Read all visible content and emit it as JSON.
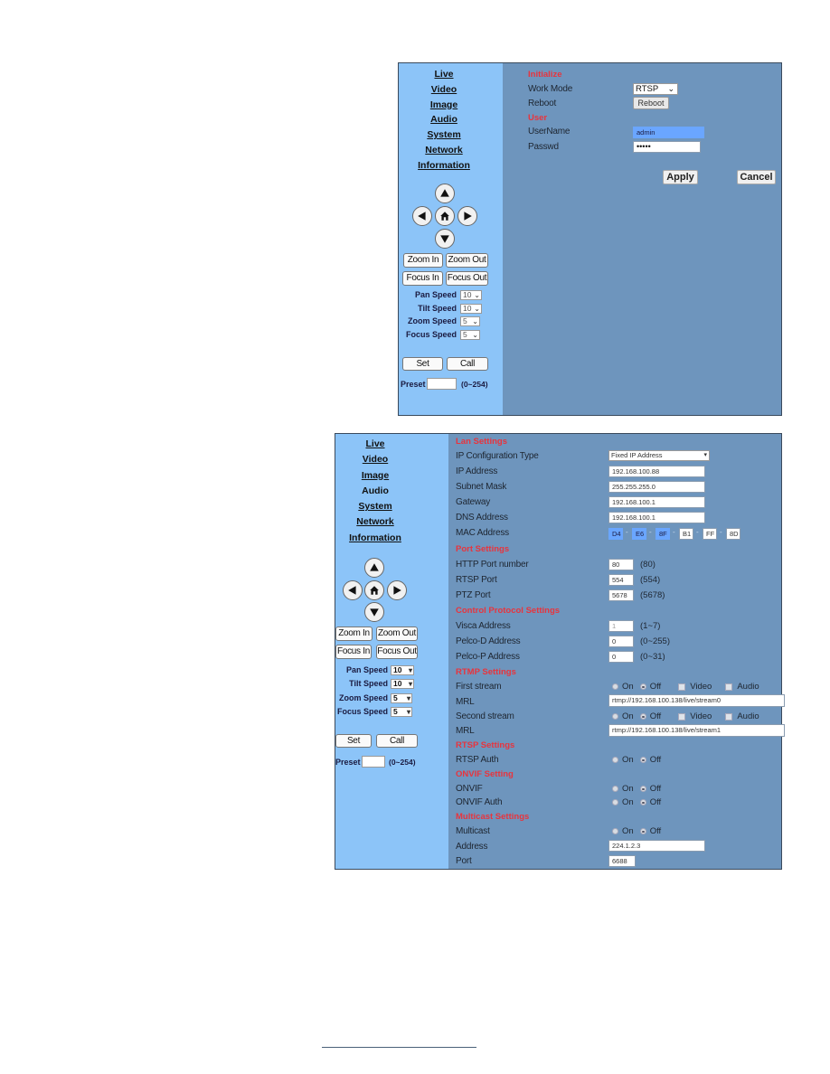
{
  "nav": {
    "items": [
      "Live",
      "Video",
      "Image",
      "Audio",
      "System",
      "Network",
      "Information"
    ]
  },
  "ptz": {
    "icons": [
      "up-arrow-icon",
      "left-arrow-icon",
      "home-icon",
      "right-arrow-icon",
      "down-arrow-icon"
    ],
    "zoom_in": "Zoom In",
    "zoom_out": "Zoom Out",
    "focus_in": "Focus In",
    "focus_out": "Focus Out",
    "speeds": [
      {
        "label": "Pan Speed",
        "value": "10"
      },
      {
        "label": "Tilt Speed",
        "value": "10"
      },
      {
        "label": "Zoom Speed",
        "value": "5"
      },
      {
        "label": "Focus Speed",
        "value": "5"
      }
    ],
    "set": "Set",
    "call": "Call",
    "preset_label": "Preset",
    "preset_value": "",
    "preset_range": "(0~254)"
  },
  "system_panel": {
    "initialize_title": "Initialize",
    "work_mode_label": "Work Mode",
    "work_mode_value": "RTSP",
    "reboot_label": "Reboot",
    "reboot_button": "Reboot",
    "user_title": "User",
    "username_label": "UserName",
    "username_value": "admin",
    "password_label": "Passwd",
    "password_value": "•••••",
    "apply": "Apply",
    "cancel": "Cancel"
  },
  "network_panel": {
    "lan_title": "Lan Settings",
    "ip_config_label": "IP Configuration Type",
    "ip_config_value": "Fixed IP Address",
    "ip_label": "IP Address",
    "ip_value": "192.168.100.88",
    "subnet_label": "Subnet Mask",
    "subnet_value": "255.255.255.0",
    "gateway_label": "Gateway",
    "gateway_value": "192.168.100.1",
    "dns_label": "DNS Address",
    "dns_value": "192.168.100.1",
    "mac_label": "MAC Address",
    "mac_values": [
      "D4",
      "E6",
      "8F",
      "B1",
      "FF",
      "8D"
    ],
    "port_title": "Port Settings",
    "http_label": "HTTP Port number",
    "http_value": "80",
    "http_default": "(80)",
    "rtsp_label": "RTSP Port",
    "rtsp_value": "554",
    "rtsp_default": "(554)",
    "ptz_label": "PTZ Port",
    "ptz_value": "5678",
    "ptz_default": "(5678)",
    "control_title": "Control Protocol Settings",
    "visca_label": "Visca Address",
    "visca_value": "1",
    "visca_range": "(1~7)",
    "pelcod_label": "Pelco-D Address",
    "pelcod_value": "0",
    "pelcod_range": "(0~255)",
    "pelcop_label": "Pelco-P Address",
    "pelcop_value": "0",
    "pelcop_range": "(0~31)",
    "rtmp_title": "RTMP Settings",
    "first_stream_label": "First stream",
    "second_stream_label": "Second stream",
    "on": "On",
    "off": "Off",
    "video": "Video",
    "audio": "Audio",
    "mrl_label": "MRL",
    "mrl1_value": "rtmp://192.168.100.138/live/stream0",
    "mrl2_value": "rtmp://192.168.100.138/live/stream1",
    "rtsp_title": "RTSP Settings",
    "rtsp_auth_label": "RTSP Auth",
    "onvif_title": "ONVIF Setting",
    "onvif_label": "ONVIF",
    "onvif_auth_label": "ONVIF Auth",
    "multicast_title": "Multicast Settings",
    "multicast_label": "Multicast",
    "address_label": "Address",
    "address_value": "224.1.2.3",
    "port_label": "Port",
    "port_value": "6688"
  }
}
